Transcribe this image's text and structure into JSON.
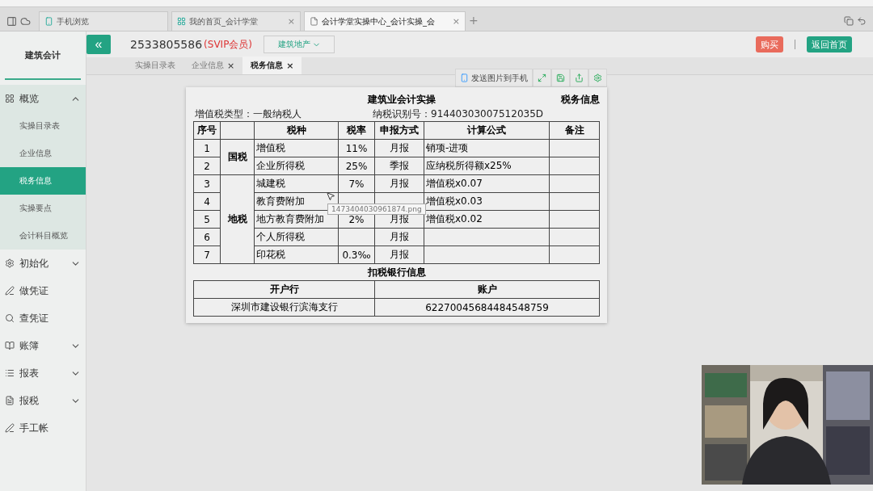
{
  "browser": {
    "tabs": [
      {
        "label": "手机浏览",
        "kind": "phone",
        "selected": false
      },
      {
        "label": "我的首页_会计学堂",
        "kind": "brand",
        "selected": false,
        "close": "×"
      },
      {
        "label": "会计学堂实操中心_会计实操_会",
        "kind": "page",
        "selected": true,
        "close": "×"
      }
    ],
    "new_tab": "+"
  },
  "header": {
    "account": "2533805586",
    "badge": "(SVIP会员)",
    "industry": "建筑地产",
    "buy": "购买",
    "home": "返回首页",
    "collapse": "«"
  },
  "sidebar": {
    "title": "建筑会计",
    "items": [
      {
        "label": "概览",
        "expanded": true,
        "children": [
          {
            "label": "实操目录表",
            "selected": false
          },
          {
            "label": "企业信息",
            "selected": false
          },
          {
            "label": "税务信息",
            "selected": true
          },
          {
            "label": "实操要点",
            "selected": false
          },
          {
            "label": "会计科目概览",
            "selected": false
          }
        ]
      },
      {
        "label": "初始化",
        "expanded": false
      },
      {
        "label": "做凭证"
      },
      {
        "label": "查凭证"
      },
      {
        "label": "账簿",
        "expanded": false
      },
      {
        "label": "报表",
        "expanded": false
      },
      {
        "label": "报税",
        "expanded": false
      },
      {
        "label": "手工帐"
      }
    ]
  },
  "page_tabs": [
    {
      "label": "实操目录表",
      "selected": false
    },
    {
      "label": "企业信息",
      "selected": false,
      "close": "×"
    },
    {
      "label": "税务信息",
      "selected": true,
      "close": "×"
    }
  ],
  "toolbar": {
    "send": "发送图片到手机"
  },
  "document": {
    "title": "建筑业会计实操",
    "section": "税务信息",
    "vat_type": "增值税类型：一般纳税人",
    "tax_id": "纳税识别号：91440303007512035D",
    "columns": [
      "序号",
      "税种",
      "税率",
      "申报方式",
      "计算公式",
      "备注"
    ],
    "groups": [
      {
        "name": "国税",
        "rows": [
          [
            "1",
            "增值税",
            "11%",
            "月报",
            "销项-进项",
            ""
          ],
          [
            "2",
            "企业所得税",
            "25%",
            "季报",
            "应纳税所得额x25%",
            ""
          ]
        ]
      },
      {
        "name": "地税",
        "rows": [
          [
            "3",
            "城建税",
            "7%",
            "月报",
            "增值税x0.07",
            ""
          ],
          [
            "4",
            "教育费附加",
            "",
            "",
            "增值税x0.03",
            ""
          ],
          [
            "5",
            "地方教育费附加",
            "2%",
            "月报",
            "增值税x0.02",
            ""
          ],
          [
            "6",
            "个人所得税",
            "",
            "月报",
            "",
            ""
          ],
          [
            "7",
            "印花税",
            "0.3‰",
            "月报",
            "",
            ""
          ]
        ]
      }
    ],
    "bank_title": "扣税银行信息",
    "bank_columns": [
      "开户行",
      "账户"
    ],
    "bank_rows": [
      [
        "深圳市建设银行滨海支行",
        "62270045684484548759"
      ]
    ]
  },
  "tooltip": "1473404030961874.png"
}
